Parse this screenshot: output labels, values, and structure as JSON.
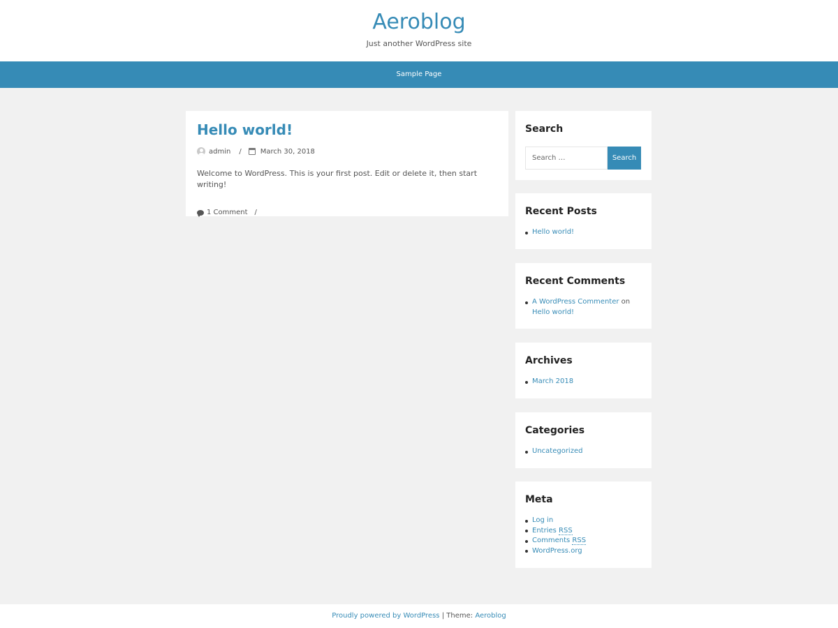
{
  "site": {
    "title": "Aeroblog",
    "description": "Just another WordPress site"
  },
  "nav": {
    "items": [
      {
        "label": "Sample Page"
      }
    ]
  },
  "post": {
    "title": "Hello world!",
    "author": "admin",
    "meta_separator": "/",
    "date": "March 30, 2018",
    "excerpt": "Welcome to WordPress. This is your first post. Edit or delete it, then start writing!",
    "comments_link": "1 Comment",
    "footer_separator": "/"
  },
  "widgets": {
    "search": {
      "title": "Search",
      "placeholder": "Search …",
      "button_label": "Search"
    },
    "recent_posts": {
      "title": "Recent Posts",
      "items": [
        "Hello world!"
      ]
    },
    "recent_comments": {
      "title": "Recent Comments",
      "items": [
        {
          "author": "A WordPress Commenter",
          "connector": "on",
          "post": "Hello world!"
        }
      ]
    },
    "archives": {
      "title": "Archives",
      "items": [
        "March 2018"
      ]
    },
    "categories": {
      "title": "Categories",
      "items": [
        "Uncategorized"
      ]
    },
    "meta": {
      "title": "Meta",
      "log_in": "Log in",
      "entries_prefix": "Entries",
      "comments_prefix": "Comments",
      "rss_abbr": "RSS",
      "wordpress_org": "WordPress.org"
    }
  },
  "footer": {
    "powered_by": "Proudly powered by WordPress",
    "separator": "|",
    "theme_label": "Theme:",
    "theme_name": "Aeroblog"
  },
  "colors": {
    "accent": "#368bb6",
    "background": "#f1f1f1",
    "card": "#ffffff",
    "heading": "#222222",
    "text": "#555555"
  }
}
